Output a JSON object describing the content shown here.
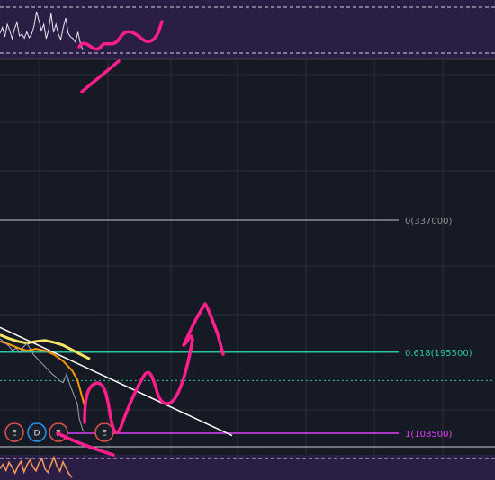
{
  "chart_data": {
    "type": "line",
    "title": "",
    "fib_levels": [
      {
        "ratio": "0",
        "price": 337000,
        "label": "0(337000)",
        "color": "#8a8d93"
      },
      {
        "ratio": "0.618",
        "price": 195500,
        "label": "0.618(195500)",
        "color": "#26c6a0"
      },
      {
        "ratio": "1",
        "price": 108500,
        "label": "1(108500)",
        "color": "#e040fb"
      }
    ],
    "dotted_level": {
      "price": 165000,
      "color": "#26c6a0"
    },
    "trendline": {
      "from": [
        0,
        222000
      ],
      "to": [
        258,
        106000
      ],
      "color": "#ffffff"
    },
    "event_markers": [
      {
        "letter": "E",
        "color": "#e0534a"
      },
      {
        "letter": "D",
        "color": "#2196f3"
      },
      {
        "letter": "E",
        "color": "#e0534a"
      },
      {
        "letter": "E",
        "color": "#e0534a"
      }
    ],
    "price_series": {
      "name": "",
      "x": [
        0,
        6,
        10,
        14,
        18,
        22,
        26,
        30,
        34,
        38,
        42,
        46,
        50,
        54,
        58,
        62,
        66,
        70,
        74,
        78,
        82,
        86,
        88,
        90,
        92,
        94
      ],
      "y": [
        210000,
        205000,
        202000,
        197000,
        200000,
        195000,
        201000,
        205000,
        198000,
        192000,
        188000,
        184000,
        180000,
        176000,
        172000,
        169000,
        165000,
        163000,
        172000,
        160000,
        150000,
        140000,
        125000,
        118000,
        112000,
        110000
      ]
    },
    "ma_series": [
      {
        "name": "",
        "color": "#f5e663",
        "x": [
          0,
          10,
          20,
          30,
          40,
          50,
          60,
          70,
          80,
          90,
          100
        ],
        "y": [
          214000,
          210000,
          207000,
          205000,
          207000,
          208000,
          206000,
          203000,
          198000,
          193000,
          188000
        ]
      },
      {
        "name": "",
        "color": "#ff9800",
        "x": [
          0,
          10,
          20,
          30,
          40,
          50,
          60,
          70,
          80,
          86,
          90,
          94
        ],
        "y": [
          207000,
          204000,
          200000,
          197000,
          199000,
          197000,
          193000,
          186000,
          176000,
          166000,
          152000,
          138000
        ]
      }
    ],
    "oscillator_top": {
      "name": "",
      "values": [
        0.42,
        0.55,
        0.34,
        0.62,
        0.48,
        0.3,
        0.52,
        0.66,
        0.36,
        0.4,
        0.31,
        0.45,
        0.32,
        0.4,
        0.58,
        0.9,
        0.7,
        0.48,
        0.62,
        0.3,
        0.5,
        0.86,
        0.44,
        0.62,
        0.4,
        0.28,
        0.56,
        0.76,
        0.42,
        0.34,
        0.3,
        0.22,
        0.45,
        0.2,
        0.05
      ]
    },
    "oscillator_bottom": {
      "name": "",
      "values": [
        0.45,
        0.62,
        0.38,
        0.7,
        0.52,
        0.28,
        0.55,
        0.74,
        0.32,
        0.6,
        0.8,
        0.52,
        0.36,
        0.68,
        0.85,
        0.44,
        0.3,
        0.62,
        0.9,
        0.55,
        0.35,
        0.72,
        0.48,
        0.25,
        0.1
      ]
    },
    "annotation_color": "#ff1e8c",
    "xlabel": "",
    "ylabel": ""
  }
}
